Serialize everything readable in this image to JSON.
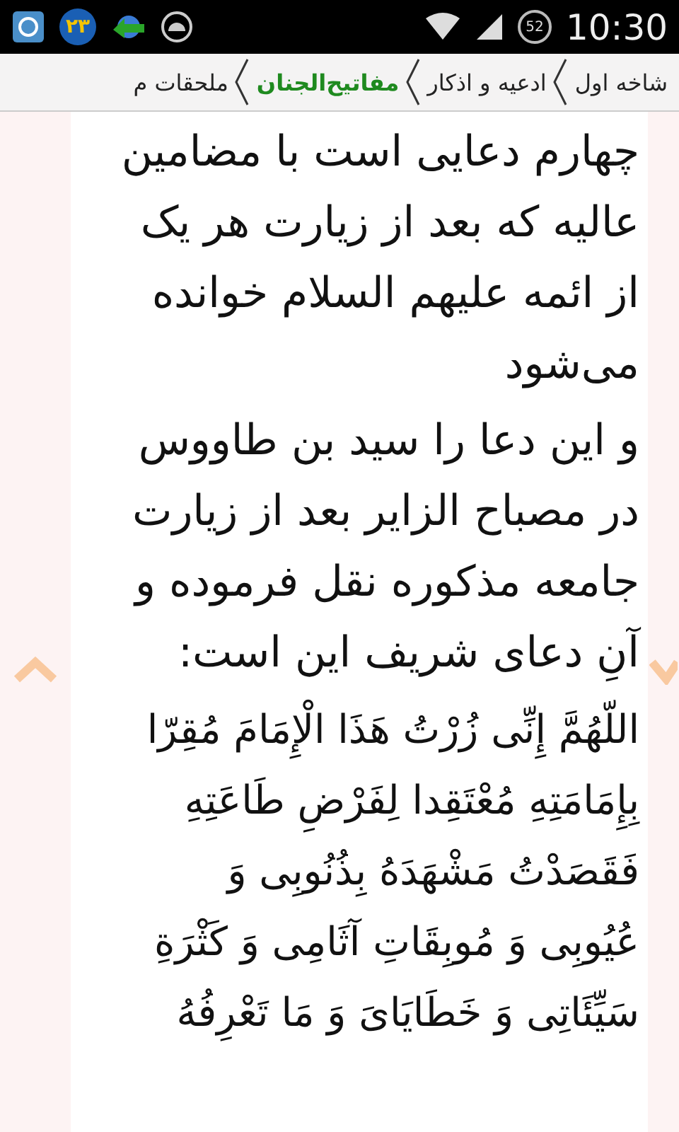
{
  "status_bar": {
    "notification_badge": "۲۳",
    "battery_level": "52",
    "time": "10:30"
  },
  "breadcrumb": [
    {
      "label": "شاخه اول",
      "selected": false
    },
    {
      "label": "ادعیه و اذکار",
      "selected": false
    },
    {
      "label": "مفاتیح‌الجنان",
      "selected": true
    },
    {
      "label": "ملحقات م",
      "selected": false
    }
  ],
  "paragraphs": [
    {
      "kind": "persian",
      "lines": [
        "چهارم دعایی است با مضامین",
        "عالیه که بعد از زیارت هر یک",
        "از ائمه علیهم السلام خوانده",
        "می‌شود"
      ]
    },
    {
      "kind": "persian",
      "lines": [
        "و این دعا را سید بن طاووس",
        "در مصباح الزایر بعد از زیارت",
        "جامعه مذکوره نقل فرموده و",
        "آنِ دعای شریف این است:"
      ]
    },
    {
      "kind": "arabic",
      "lines": [
        "اللّهُمَّ إِنِّی زُرْتُ هَذَا الْإِمَامَ مُقِرّا",
        "بِإِمَامَتِهِ مُعْتَقِدا لِفَرْضِ طَاعَتِهِ",
        "فَقَصَدْتُ مَشْهَدَهُ بِذُنُوبِی وَ",
        "عُیُوبِی وَ مُوبِقَاتِ آثَامِی وَ کَثْرَةِ",
        "سَیِّئَاتِی وَ خَطَایَایَ وَ مَا تَعْرِفُهُ"
      ]
    }
  ]
}
